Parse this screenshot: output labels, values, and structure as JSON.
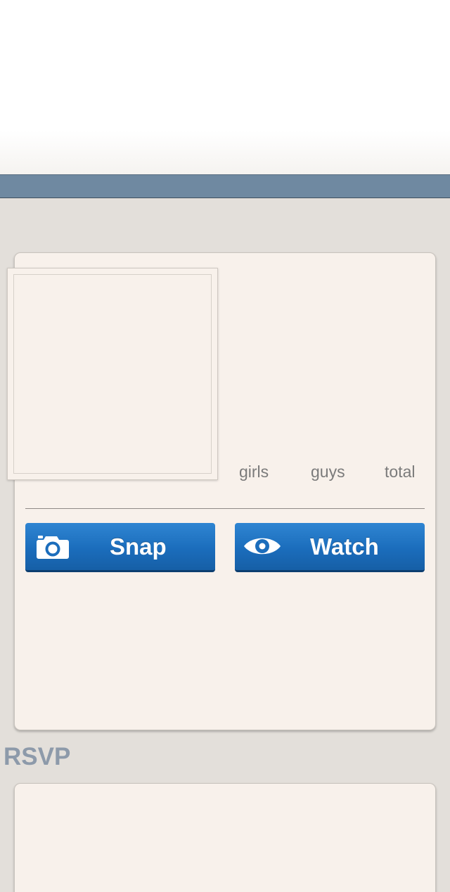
{
  "stats": {
    "girls_label": "girls",
    "guys_label": "guys",
    "total_label": "total"
  },
  "actions": {
    "snap_label": "Snap",
    "watch_label": "Watch"
  },
  "rsvp": {
    "title": "RSVP"
  },
  "colors": {
    "nav_bar": "#6f89a1",
    "button_blue": "#1b6dbc",
    "card_bg": "#f8f1eb",
    "page_bg": "#e3dfda"
  },
  "icons": {
    "snap": "camera-icon",
    "watch": "eye-icon"
  }
}
